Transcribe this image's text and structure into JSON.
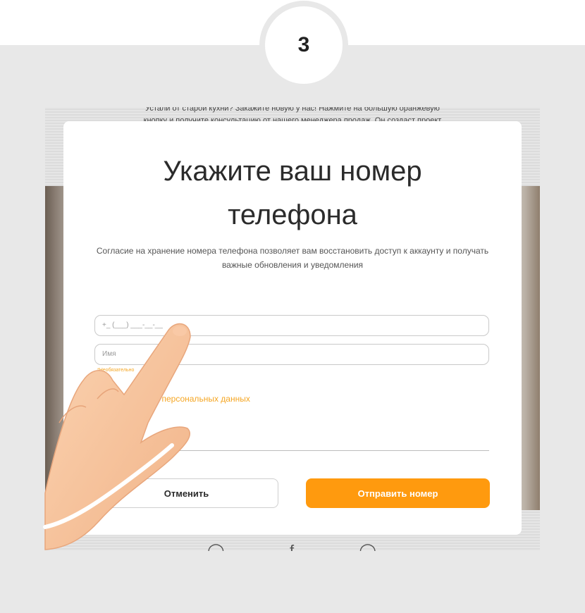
{
  "step": {
    "number": "3"
  },
  "background_page": {
    "text_line_1": "Устали от старой кухни? Закажите новую у нас! Нажмите на большую оранжевую",
    "text_line_2": "кнопку и получите консультацию от нашего менеджера продаж. Он создаст проект"
  },
  "modal": {
    "title": "Укажите  ваш номер телефона",
    "description": "Согласие на хранение номера телефона позволяет вам восстановить доступ к аккаунту и получать важные обновления и уведомления",
    "phone_placeholder": "+_ (___) ___-__-__",
    "name_placeholder": "Имя",
    "name_note": "*Необязательно",
    "consent_label": "сен    работку персональных данных",
    "cancel_label": "Отменить",
    "submit_label": "Отправить номер"
  },
  "colors": {
    "accent": "#ff9a0e",
    "note": "#f5a623",
    "skin": "#f6c49e"
  }
}
